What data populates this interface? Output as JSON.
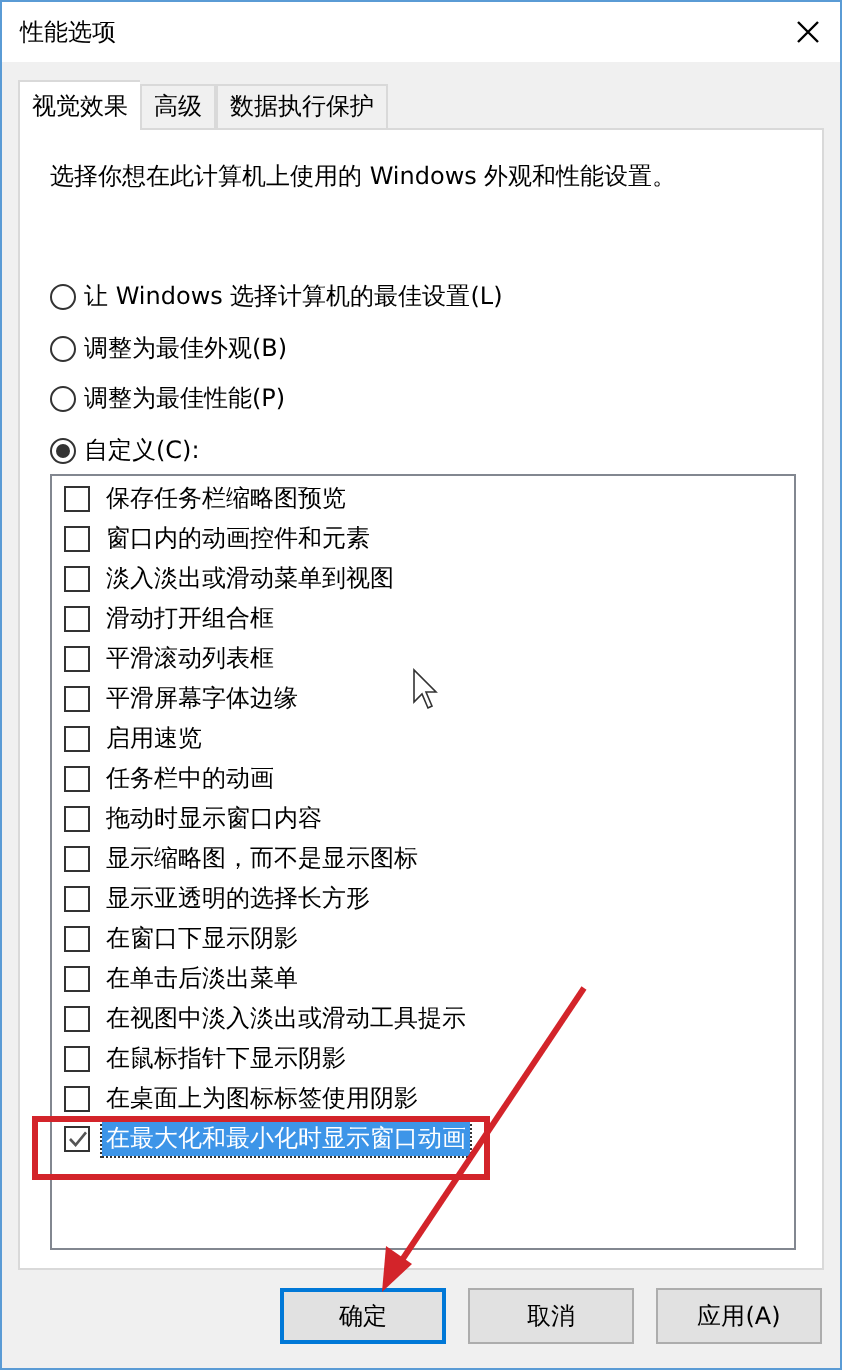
{
  "window": {
    "title": "性能选项"
  },
  "tabs": [
    {
      "label": "视觉效果",
      "selected": true
    },
    {
      "label": "高级",
      "selected": false
    },
    {
      "label": "数据执行保护",
      "selected": false
    }
  ],
  "description": "选择你想在此计算机上使用的 Windows 外观和性能设置。",
  "options": [
    {
      "label": "让 Windows 选择计算机的最佳设置(L)",
      "selected": false
    },
    {
      "label": "调整为最佳外观(B)",
      "selected": false
    },
    {
      "label": "调整为最佳性能(P)",
      "selected": false
    },
    {
      "label": "自定义(C):",
      "selected": true
    }
  ],
  "settings": [
    {
      "label": "保存任务栏缩略图预览",
      "checked": false,
      "selected": false
    },
    {
      "label": "窗口内的动画控件和元素",
      "checked": false,
      "selected": false
    },
    {
      "label": "淡入淡出或滑动菜单到视图",
      "checked": false,
      "selected": false
    },
    {
      "label": "滑动打开组合框",
      "checked": false,
      "selected": false
    },
    {
      "label": "平滑滚动列表框",
      "checked": false,
      "selected": false
    },
    {
      "label": "平滑屏幕字体边缘",
      "checked": false,
      "selected": false
    },
    {
      "label": "启用速览",
      "checked": false,
      "selected": false
    },
    {
      "label": "任务栏中的动画",
      "checked": false,
      "selected": false
    },
    {
      "label": "拖动时显示窗口内容",
      "checked": false,
      "selected": false
    },
    {
      "label": "显示缩略图，而不是显示图标",
      "checked": false,
      "selected": false
    },
    {
      "label": "显示亚透明的选择长方形",
      "checked": false,
      "selected": false
    },
    {
      "label": "在窗口下显示阴影",
      "checked": false,
      "selected": false
    },
    {
      "label": "在单击后淡出菜单",
      "checked": false,
      "selected": false
    },
    {
      "label": "在视图中淡入淡出或滑动工具提示",
      "checked": false,
      "selected": false
    },
    {
      "label": "在鼠标指针下显示阴影",
      "checked": false,
      "selected": false
    },
    {
      "label": "在桌面上为图标标签使用阴影",
      "checked": false,
      "selected": false
    },
    {
      "label": "在最大化和最小化时显示窗口动画",
      "checked": true,
      "selected": true
    }
  ],
  "buttons": [
    {
      "label": "确定",
      "default": true
    },
    {
      "label": "取消",
      "default": false
    },
    {
      "label": "应用(A)",
      "default": false
    }
  ]
}
